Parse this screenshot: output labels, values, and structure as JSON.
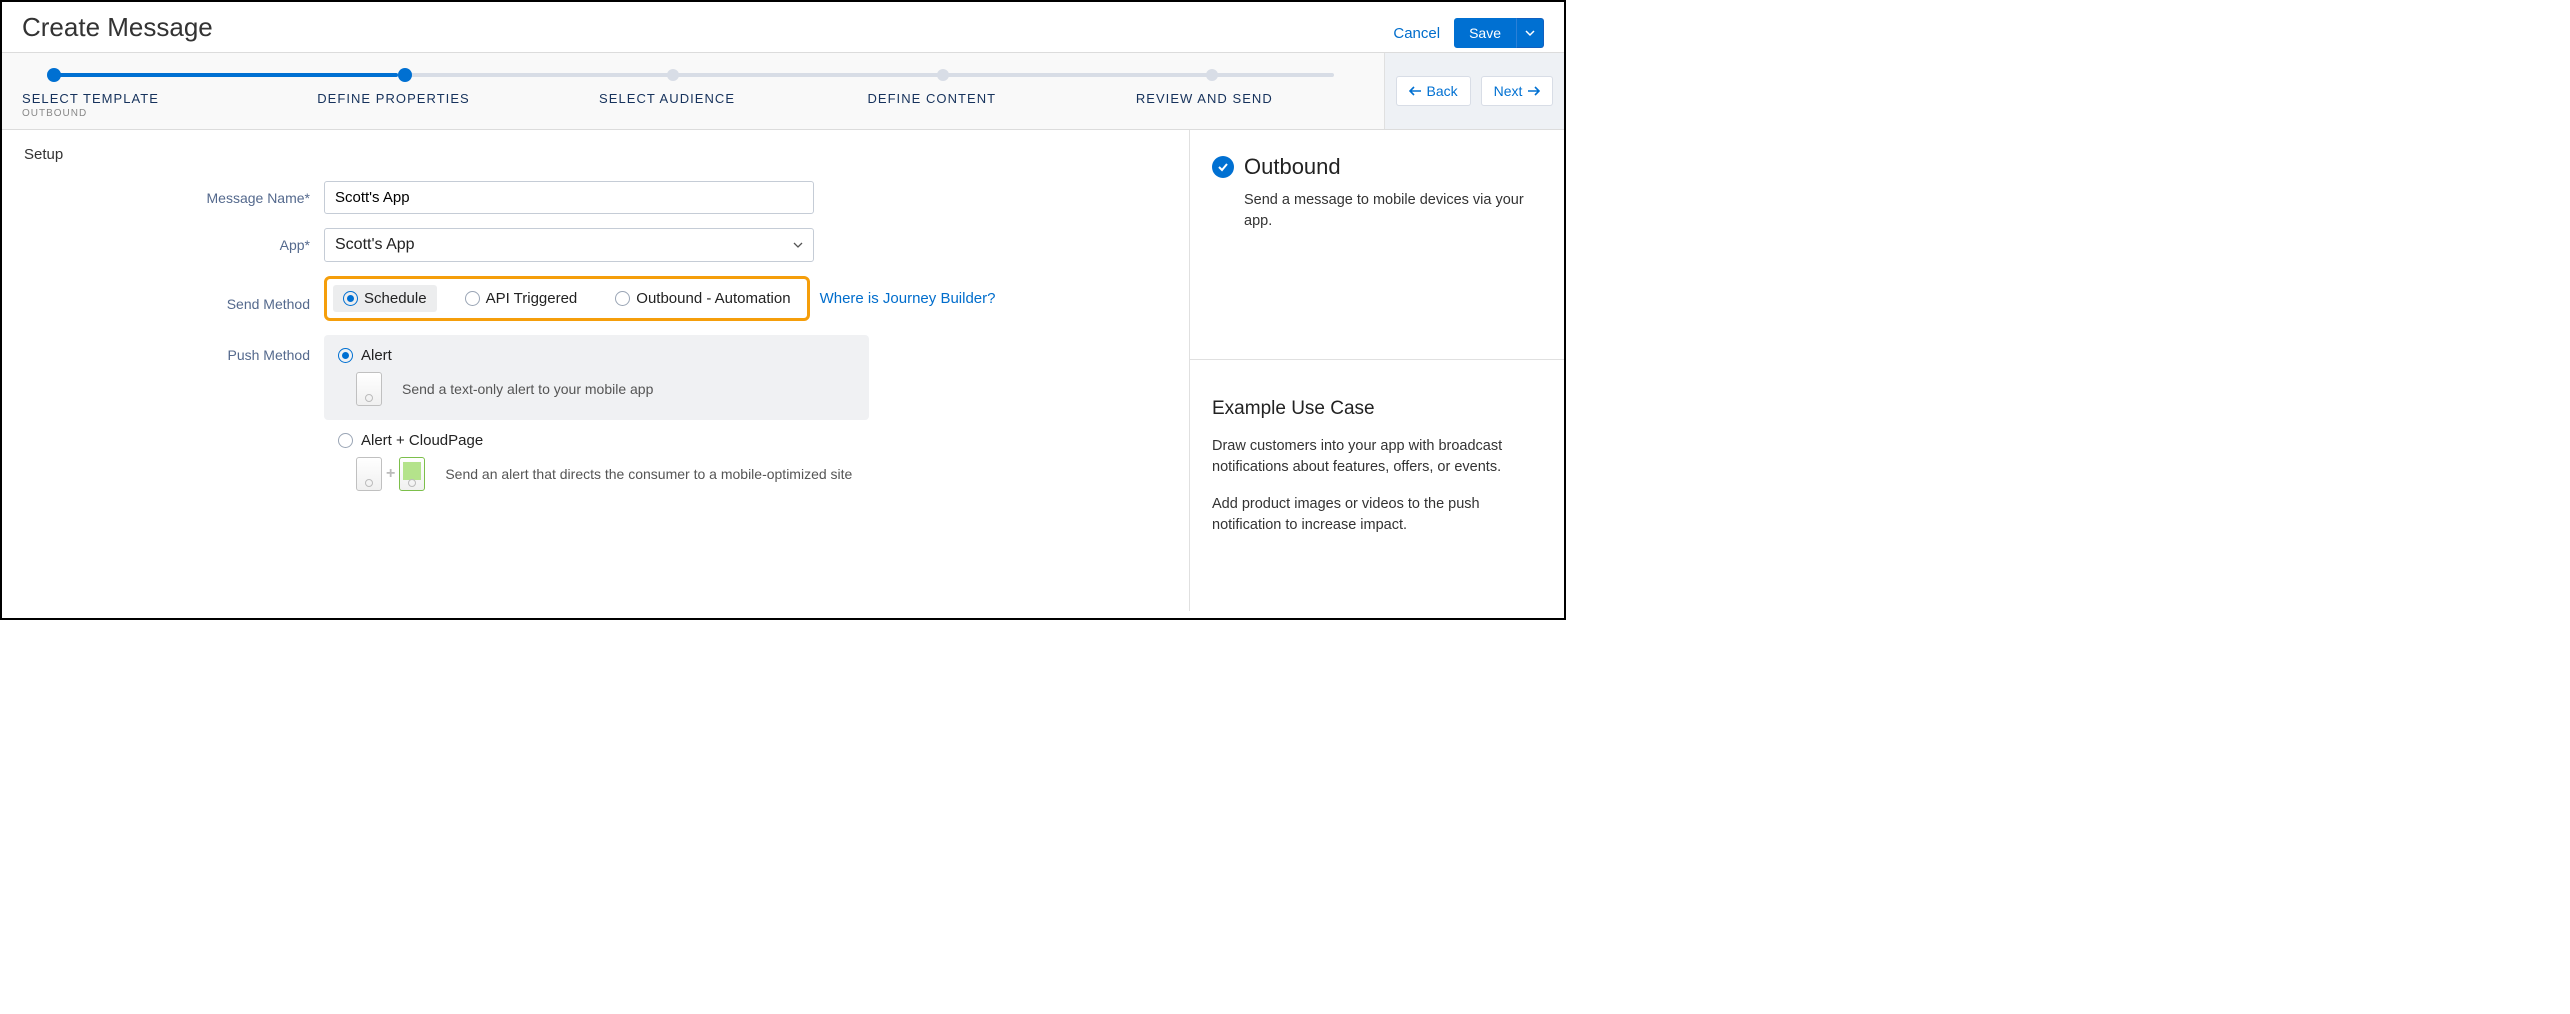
{
  "header": {
    "title": "Create Message",
    "cancel": "Cancel",
    "save": "Save"
  },
  "progress": {
    "steps": [
      {
        "label": "SELECT TEMPLATE",
        "sub": "OUTBOUND"
      },
      {
        "label": "DEFINE PROPERTIES"
      },
      {
        "label": "SELECT AUDIENCE"
      },
      {
        "label": "DEFINE CONTENT"
      },
      {
        "label": "REVIEW AND SEND"
      }
    ],
    "active_index": 1
  },
  "nav": {
    "back": "Back",
    "next": "Next"
  },
  "form": {
    "section_title": "Setup",
    "message_name_label": "Message Name*",
    "message_name_value": "Scott's App",
    "app_label": "App*",
    "app_value": "Scott's App",
    "send_method_label": "Send Method",
    "send_methods": [
      "Schedule",
      "API Triggered",
      "Outbound - Automation"
    ],
    "send_method_selected": 0,
    "journey_link": "Where is Journey Builder?",
    "push_method_label": "Push Method",
    "push_options": [
      {
        "title": "Alert",
        "desc": "Send a text-only alert to your mobile app"
      },
      {
        "title": "Alert + CloudPage",
        "desc": "Send an alert that directs the consumer to a mobile-optimized site"
      }
    ],
    "push_selected": 0
  },
  "sidebar": {
    "template_title": "Outbound",
    "template_desc": "Send a message to mobile devices via your app.",
    "example_title": "Example Use Case",
    "example_p1": "Draw customers into your app with broadcast notifications about features, offers, or events.",
    "example_p2": "Add product images or videos to the push notification to increase impact."
  }
}
